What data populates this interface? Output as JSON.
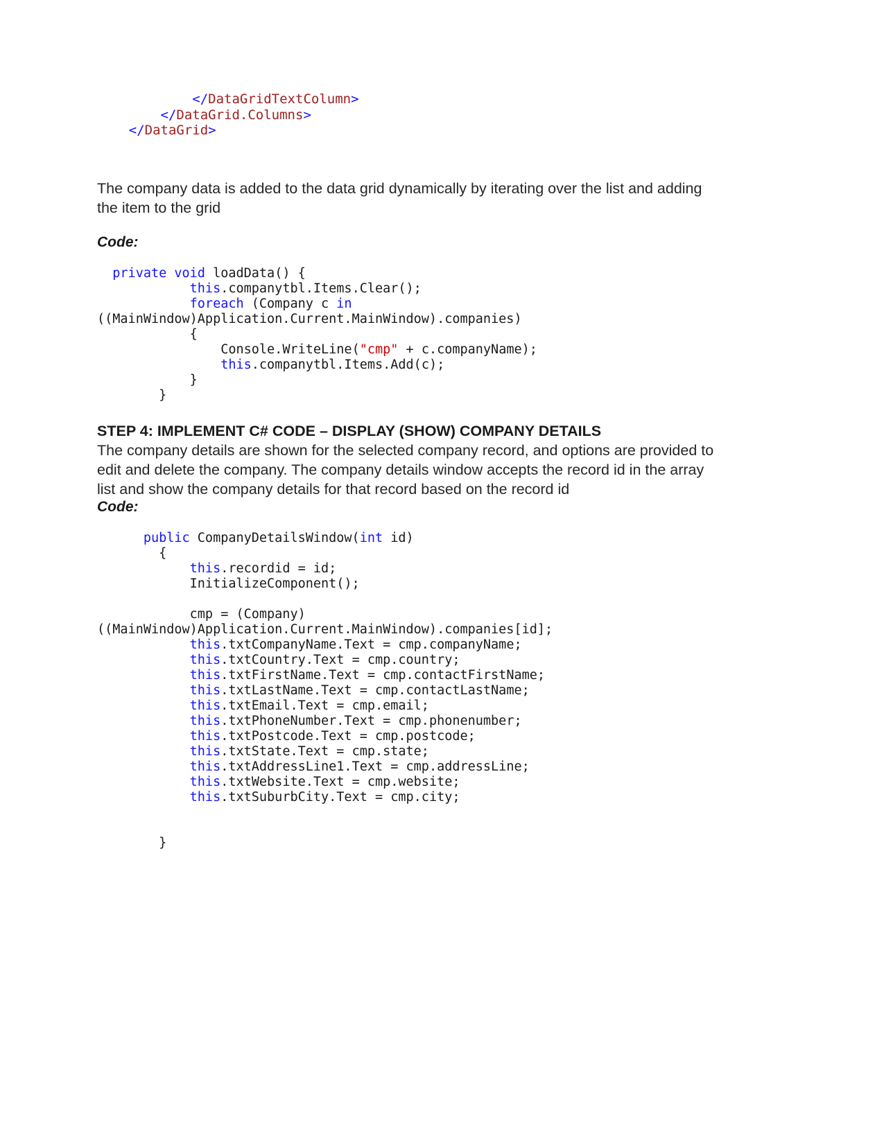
{
  "document": {
    "xml_snippet": {
      "name": "datagrid-closing-tags",
      "lines": [
        {
          "indent": 24,
          "tag": "</DataGridTextColumn>"
        },
        {
          "indent": 16,
          "tag": "</DataGrid.Columns>"
        },
        {
          "indent": 8,
          "tag": "</DataGrid>"
        }
      ],
      "raw": "            </DataGridTextColumn>\n        </DataGrid.Columns>\n    </DataGrid>"
    },
    "intro_paragraph": "The company data is added to the data grid dynamically by iterating over the list and adding the item to the grid",
    "code_label_1": "Code:",
    "code_block_1": "  private void loadData() {\n            this.companytbl.Items.Clear();\n            foreach (Company c in\n((MainWindow)Application.Current.MainWindow).companies)\n            {\n                Console.WriteLine(\"cmp\" + c.companyName);\n                this.companytbl.Items.Add(c);\n            }\n        }",
    "step4_heading": "STEP 4: IMPLEMENT C# CODE – DISPLAY (SHOW) COMPANY DETAILS",
    "step4_paragraph": "The company details are shown for the selected company record, and options are provided to edit and delete the company. The company details window accepts the record id in the array list and show the company details for that record based on the record id",
    "code_label_2": "Code:",
    "code_block_2": "      public CompanyDetailsWindow(int id)\n        {\n            this.recordid = id;\n            InitializeComponent();\n\n            cmp = (Company)\n((MainWindow)Application.Current.MainWindow).companies[id];\n            this.txtCompanyName.Text = cmp.companyName;\n            this.txtCountry.Text = cmp.country;\n            this.txtFirstName.Text = cmp.contactFirstName;\n            this.txtLastName.Text = cmp.contactLastName;\n            this.txtEmail.Text = cmp.email;\n            this.txtPhoneNumber.Text = cmp.phonenumber;\n            this.txtPostcode.Text = cmp.postcode;\n            this.txtState.Text = cmp.state;\n            this.txtAddressLine1.Text = cmp.addressLine;\n            this.txtWebsite.Text = cmp.website;\n            this.txtSuburbCity.Text = cmp.city;\n\n\n        }"
  },
  "code_tokens": {
    "block1": [
      {
        "indent": "  ",
        "parts": [
          {
            "t": "kw",
            "v": "private"
          },
          {
            "t": "p",
            "v": " "
          },
          {
            "t": "kw",
            "v": "void"
          },
          {
            "t": "p",
            "v": " loadData() {"
          }
        ]
      },
      {
        "indent": "            ",
        "parts": [
          {
            "t": "kw",
            "v": "this"
          },
          {
            "t": "p",
            "v": ".companytbl.Items.Clear();"
          }
        ]
      },
      {
        "indent": "            ",
        "parts": [
          {
            "t": "kw",
            "v": "foreach"
          },
          {
            "t": "p",
            "v": " (Company c "
          },
          {
            "t": "kw",
            "v": "in"
          }
        ]
      },
      {
        "indent": "",
        "parts": [
          {
            "t": "p",
            "v": "((MainWindow)Application.Current.MainWindow).companies)"
          }
        ]
      },
      {
        "indent": "            ",
        "parts": [
          {
            "t": "p",
            "v": "{"
          }
        ]
      },
      {
        "indent": "                ",
        "parts": [
          {
            "t": "p",
            "v": "Console.WriteLine("
          },
          {
            "t": "str",
            "v": "\"cmp\""
          },
          {
            "t": "p",
            "v": " + c.companyName);"
          }
        ]
      },
      {
        "indent": "                ",
        "parts": [
          {
            "t": "kw",
            "v": "this"
          },
          {
            "t": "p",
            "v": ".companytbl.Items.Add(c);"
          }
        ]
      },
      {
        "indent": "            ",
        "parts": [
          {
            "t": "p",
            "v": "}"
          }
        ]
      },
      {
        "indent": "        ",
        "parts": [
          {
            "t": "p",
            "v": "}"
          }
        ]
      }
    ],
    "block2": [
      {
        "indent": "      ",
        "parts": [
          {
            "t": "kw",
            "v": "public"
          },
          {
            "t": "p",
            "v": " CompanyDetailsWindow("
          },
          {
            "t": "kw",
            "v": "int"
          },
          {
            "t": "p",
            "v": " id)"
          }
        ]
      },
      {
        "indent": "        ",
        "parts": [
          {
            "t": "p",
            "v": "{"
          }
        ]
      },
      {
        "indent": "            ",
        "parts": [
          {
            "t": "kw",
            "v": "this"
          },
          {
            "t": "p",
            "v": ".recordid = id;"
          }
        ]
      },
      {
        "indent": "            ",
        "parts": [
          {
            "t": "p",
            "v": "InitializeComponent();"
          }
        ]
      },
      {
        "indent": "",
        "parts": [
          {
            "t": "p",
            "v": ""
          }
        ]
      },
      {
        "indent": "            ",
        "parts": [
          {
            "t": "p",
            "v": "cmp = (Company)"
          }
        ]
      },
      {
        "indent": "",
        "parts": [
          {
            "t": "p",
            "v": "((MainWindow)Application.Current.MainWindow).companies[id];"
          }
        ]
      },
      {
        "indent": "            ",
        "parts": [
          {
            "t": "kw",
            "v": "this"
          },
          {
            "t": "p",
            "v": ".txtCompanyName.Text = cmp.companyName;"
          }
        ]
      },
      {
        "indent": "            ",
        "parts": [
          {
            "t": "kw",
            "v": "this"
          },
          {
            "t": "p",
            "v": ".txtCountry.Text = cmp.country;"
          }
        ]
      },
      {
        "indent": "            ",
        "parts": [
          {
            "t": "kw",
            "v": "this"
          },
          {
            "t": "p",
            "v": ".txtFirstName.Text = cmp.contactFirstName;"
          }
        ]
      },
      {
        "indent": "            ",
        "parts": [
          {
            "t": "kw",
            "v": "this"
          },
          {
            "t": "p",
            "v": ".txtLastName.Text = cmp.contactLastName;"
          }
        ]
      },
      {
        "indent": "            ",
        "parts": [
          {
            "t": "kw",
            "v": "this"
          },
          {
            "t": "p",
            "v": ".txtEmail.Text = cmp.email;"
          }
        ]
      },
      {
        "indent": "            ",
        "parts": [
          {
            "t": "kw",
            "v": "this"
          },
          {
            "t": "p",
            "v": ".txtPhoneNumber.Text = cmp.phonenumber;"
          }
        ]
      },
      {
        "indent": "            ",
        "parts": [
          {
            "t": "kw",
            "v": "this"
          },
          {
            "t": "p",
            "v": ".txtPostcode.Text = cmp.postcode;"
          }
        ]
      },
      {
        "indent": "            ",
        "parts": [
          {
            "t": "kw",
            "v": "this"
          },
          {
            "t": "p",
            "v": ".txtState.Text = cmp.state;"
          }
        ]
      },
      {
        "indent": "            ",
        "parts": [
          {
            "t": "kw",
            "v": "this"
          },
          {
            "t": "p",
            "v": ".txtAddressLine1.Text = cmp.addressLine;"
          }
        ]
      },
      {
        "indent": "            ",
        "parts": [
          {
            "t": "kw",
            "v": "this"
          },
          {
            "t": "p",
            "v": ".txtWebsite.Text = cmp.website;"
          }
        ]
      },
      {
        "indent": "            ",
        "parts": [
          {
            "t": "kw",
            "v": "this"
          },
          {
            "t": "p",
            "v": ".txtSuburbCity.Text = cmp.city;"
          }
        ]
      },
      {
        "indent": "",
        "parts": [
          {
            "t": "p",
            "v": ""
          }
        ]
      },
      {
        "indent": "",
        "parts": [
          {
            "t": "p",
            "v": ""
          }
        ]
      },
      {
        "indent": "        ",
        "parts": [
          {
            "t": "p",
            "v": "}"
          }
        ]
      }
    ],
    "xml": [
      {
        "indent": "            ",
        "parts": [
          {
            "t": "ang",
            "v": "</"
          },
          {
            "t": "tag",
            "v": "DataGridTextColumn"
          },
          {
            "t": "ang",
            "v": ">"
          }
        ]
      },
      {
        "indent": "        ",
        "parts": [
          {
            "t": "ang",
            "v": "</"
          },
          {
            "t": "tag",
            "v": "DataGrid.Columns"
          },
          {
            "t": "ang",
            "v": ">"
          }
        ]
      },
      {
        "indent": "    ",
        "parts": [
          {
            "t": "ang",
            "v": "</"
          },
          {
            "t": "tag",
            "v": "DataGrid"
          },
          {
            "t": "ang",
            "v": ">"
          }
        ]
      }
    ]
  },
  "colors": {
    "keyword": "#1414ff",
    "string": "#cc0000",
    "xml_tag": "#a02020",
    "xml_bracket": "#1414ff",
    "body_text": "#262626",
    "page_background": "#ffffff"
  }
}
